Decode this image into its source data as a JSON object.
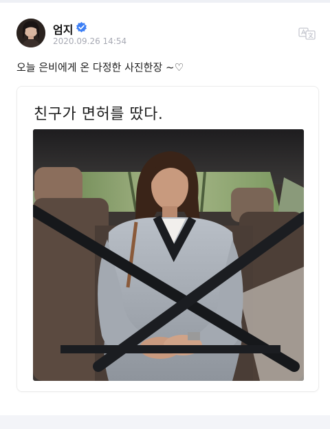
{
  "post": {
    "author_name": "엄지",
    "timestamp": "2020.09.26 14:54",
    "caption": "오늘 은비에게 온 다정한 사진한장 ~♡",
    "image_card": {
      "title": "친구가 면허를 땄다."
    }
  },
  "icons": {
    "verified": "verified-badge-icon",
    "translate": "translate-icon"
  },
  "colors": {
    "verified_blue": "#3d7ff5",
    "timestamp_gray": "#a7a9b3",
    "background": "#f3f4f8"
  }
}
